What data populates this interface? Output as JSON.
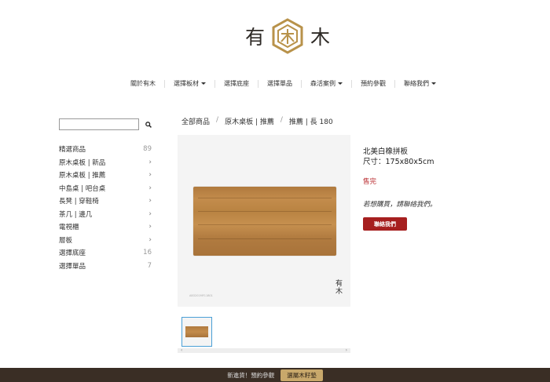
{
  "brand": {
    "char_left": "有",
    "char_right": "木",
    "accent": "#b8924a"
  },
  "nav": [
    {
      "label": "關於有木",
      "dropdown": false
    },
    {
      "label": "選擇板材",
      "dropdown": true
    },
    {
      "label": "選擇底座",
      "dropdown": false
    },
    {
      "label": "選擇單品",
      "dropdown": false
    },
    {
      "label": "森活案例",
      "dropdown": true
    },
    {
      "label": "預約參觀",
      "dropdown": false
    },
    {
      "label": "聯絡我們",
      "dropdown": true
    }
  ],
  "search": {
    "placeholder": "",
    "icon": "search-icon"
  },
  "categories": [
    {
      "label": "精選商品",
      "count": "89",
      "chevron": ""
    },
    {
      "label": "原木桌板 | 新品",
      "count": "",
      "chevron": "›"
    },
    {
      "label": "原木桌板 | 推薦",
      "count": "",
      "chevron": "›"
    },
    {
      "label": "中島桌 | 吧台桌",
      "count": "",
      "chevron": "›"
    },
    {
      "label": "長凳 | 穿鞋椅",
      "count": "",
      "chevron": "›"
    },
    {
      "label": "茶几 | 邊几",
      "count": "",
      "chevron": "›"
    },
    {
      "label": "電視櫃",
      "count": "",
      "chevron": "›"
    },
    {
      "label": "層板",
      "count": "",
      "chevron": "›"
    },
    {
      "label": "選擇底座",
      "count": "16",
      "chevron": ""
    },
    {
      "label": "選擇單品",
      "count": "7",
      "chevron": ""
    }
  ],
  "breadcrumb": [
    "全部商品",
    "原木桌板 | 推薦",
    "推薦 | 長 180"
  ],
  "product": {
    "name": "北美白橡拼板",
    "size": "尺寸：175x80x5cm",
    "status": "售完",
    "note": "若想購買，請聯絡我們。",
    "contact_label": "聯絡我們",
    "image_caption": "AB3201MF11801",
    "image_logo_top": "有",
    "image_logo_bottom": "木"
  },
  "footer": {
    "text": "新進貨！預約參觀",
    "button_label": "選屬木籽墊"
  }
}
